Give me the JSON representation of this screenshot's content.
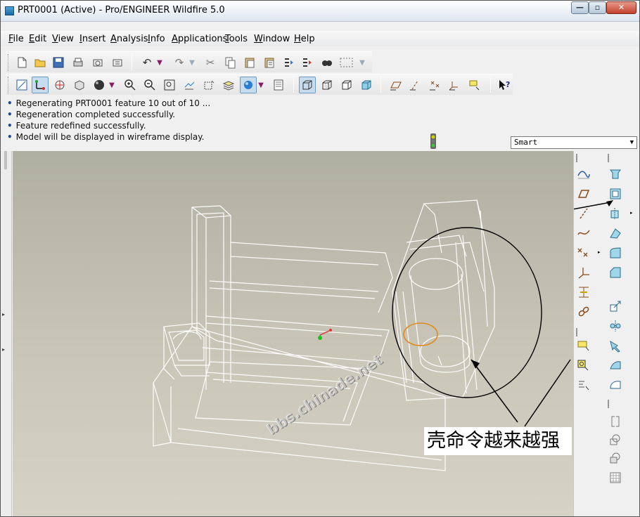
{
  "window": {
    "title": "PRT0001 (Active) - Pro/ENGINEER Wildfire 5.0"
  },
  "menu": [
    {
      "label": "File"
    },
    {
      "label": "Edit"
    },
    {
      "label": "View"
    },
    {
      "label": "Insert"
    },
    {
      "label": "Analysis"
    },
    {
      "label": "Info"
    },
    {
      "label": "Applications"
    },
    {
      "label": "Tools"
    },
    {
      "label": "Window"
    },
    {
      "label": "Help"
    }
  ],
  "messages": [
    "Regenerating PRT0001 feature 10 out of 10 ...",
    "Regeneration completed successfully.",
    "Feature redefined successfully.",
    "Model will be displayed in wireframe display."
  ],
  "selection_filter": {
    "value": "Smart"
  },
  "viewport": {
    "watermark": "bbs.chinade.net",
    "caption": "壳命令越来越强"
  },
  "colors": {
    "titlebar": "#dde6f0",
    "viewport_top": "#afafa2",
    "viewport_bottom": "#d6d2c6",
    "wireframe": "#ffffff",
    "highlight": "#e08a20",
    "annotation": "#000000"
  }
}
